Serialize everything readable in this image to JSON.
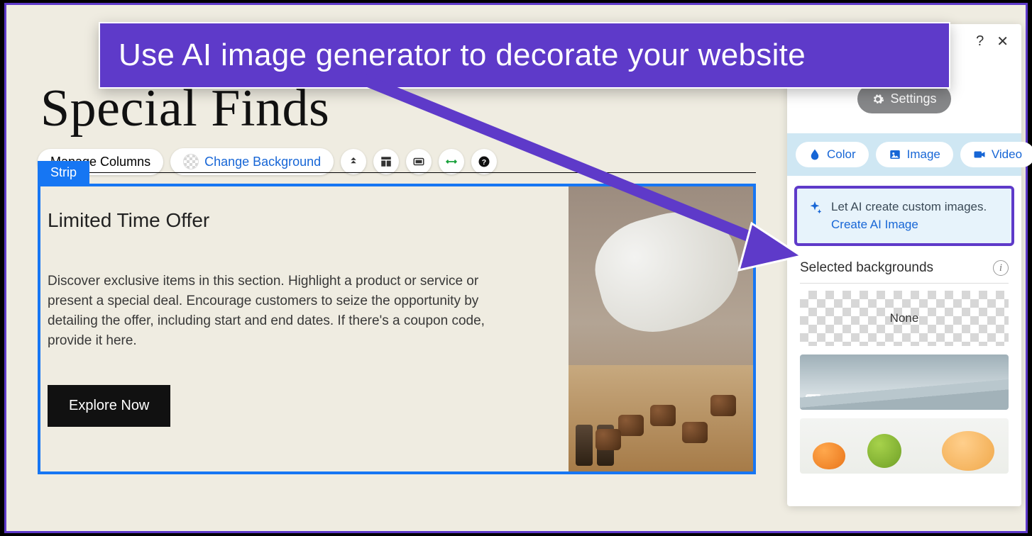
{
  "callout": {
    "text": "Use AI image generator to decorate your website"
  },
  "page": {
    "title": "Special Finds"
  },
  "toolbar": {
    "manage_columns": "Manage Columns",
    "change_background": "Change Background"
  },
  "strip": {
    "label": "Strip",
    "heading": "Limited Time Offer",
    "body": "Discover exclusive items in this section. Highlight a product or service or present a special deal. Encourage customers to seize the opportunity by detailing the offer, including start and end dates. If there's a coupon code, provide it here.",
    "button": "Explore Now"
  },
  "panel": {
    "help": "?",
    "close": "✕",
    "settings": "Settings",
    "tabs": {
      "color": "Color",
      "image": "Image",
      "video": "Video"
    },
    "ai": {
      "text": "Let AI create custom images. ",
      "link": "Create AI Image"
    },
    "selected_label": "Selected backgrounds",
    "none_label": "None"
  }
}
